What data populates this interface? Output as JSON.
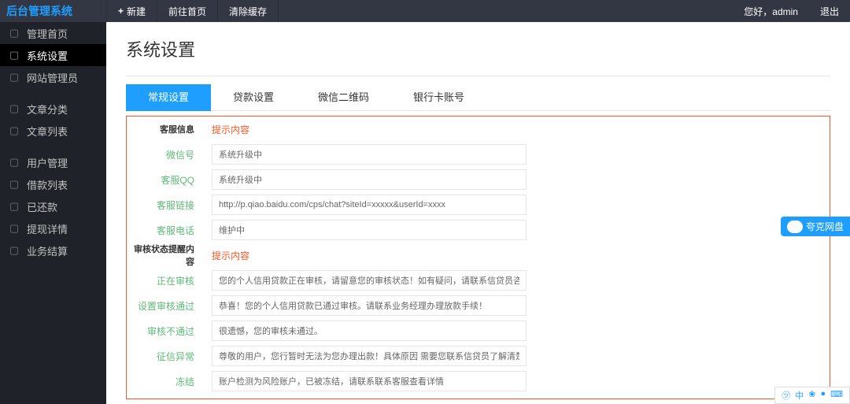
{
  "topbar": {
    "logo": "后台管理系统",
    "new_label": "新建",
    "home_label": "前往首页",
    "clear_label": "清除缓存",
    "greeting": "您好，admin",
    "logout": "退出"
  },
  "sidebar": {
    "items": [
      {
        "label": "管理首页",
        "icon": "home"
      },
      {
        "label": "系统设置",
        "icon": "gear",
        "active": true
      },
      {
        "label": "网站管理员",
        "icon": "user"
      },
      {
        "label": "文章分类",
        "icon": "list"
      },
      {
        "label": "文章列表",
        "icon": "doc"
      },
      {
        "label": "用户管理",
        "icon": "users"
      },
      {
        "label": "借款列表",
        "icon": "money"
      },
      {
        "label": "已还款",
        "icon": "check"
      },
      {
        "label": "提现详情",
        "icon": "detail"
      },
      {
        "label": "业务结算",
        "icon": "settle"
      }
    ]
  },
  "main": {
    "title": "系统设置",
    "tabs": [
      {
        "label": "常规设置",
        "active": true
      },
      {
        "label": "贷款设置"
      },
      {
        "label": "微信二维码"
      },
      {
        "label": "银行卡账号"
      }
    ],
    "sections": {
      "kefu": {
        "header": "客服信息",
        "hint": "提示内容",
        "fields": [
          {
            "label": "微信号",
            "value": "系统升级中"
          },
          {
            "label": "客服QQ",
            "value": "系统升级中"
          },
          {
            "label": "客服链接",
            "value": "http://p.qiao.baidu.com/cps/chat?siteId=xxxxx&userId=xxxx"
          },
          {
            "label": "客服电话",
            "value": "维护中"
          }
        ]
      },
      "audit": {
        "header": "审核状态提醒内容",
        "hint": "提示内容",
        "fields": [
          {
            "label": "正在审核",
            "value": "您的个人信用贷款正在审核，请留意您的审核状态！如有疑问，请联系信贷员咨询..."
          },
          {
            "label": "设置审核通过",
            "value": "恭喜！您的个人信用贷款已通过审核。请联系业务经理办理放款手续！"
          },
          {
            "label": "审核不通过",
            "value": "很遗憾，您的审核未通过。"
          },
          {
            "label": "征信异常",
            "value": "尊敬的用户，您行暂时无法为您办理出款！具体原因 需要您联系信贷员了解清楚.这笔借款具体到账时"
          },
          {
            "label": "冻结",
            "value": "账户检测为风险账户，已被冻结，请联系联系客服查看详情"
          }
        ]
      }
    }
  },
  "float": {
    "label": "夸克网盘"
  },
  "ime": {
    "items": [
      "㋡",
      "中",
      "❀",
      "●",
      "⌨"
    ]
  }
}
